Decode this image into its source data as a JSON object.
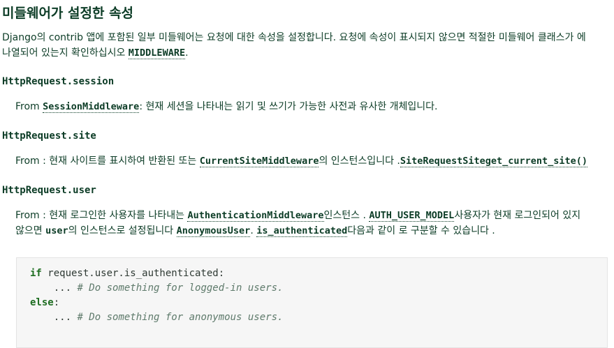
{
  "heading": "미들웨어가 설정한 속성",
  "intro": {
    "text": "Django의 contrib 앱에 포함된 일부 미들웨어는 요청에 대한 속성을 설정합니다. 요청에 속성이 표시되지 않으면 적절한 미들웨어 클래스가 에",
    "text2": "나열되어 있는지 확인하십시오 ",
    "code": "MIDDLEWARE",
    "end": "."
  },
  "session": {
    "title": "HttpRequest.session",
    "from": "From ",
    "code": "SessionMiddleware",
    "rest": ": 현재 세션을 나타내는 읽기 및 쓰기가 가능한 사전과 유사한 개체입니다."
  },
  "site": {
    "title": "HttpRequest.site",
    "from": "From : 현재 사이트를 표시하여 반환된 또는 ",
    "code1": "CurrentSiteMiddleware",
    "mid": "의 인스턴스입니다 .",
    "code2": "SiteRequestSiteget_current_site()"
  },
  "user": {
    "title": "HttpRequest.user",
    "from": "From : 현재 로그인한 사용자를 나타내는 ",
    "code1": "AuthenticationMiddleware",
    "mid1": "인스턴스 . ",
    "code2": "AUTH_USER_MODEL",
    "mid2": "사용자가 현재 로그인되어 있지",
    "line2a": "않으면 ",
    "code3": "user",
    "mid3": "의 인스턴스로 설정됩니다 ",
    "code4": "AnonymousUser",
    "sep": ". ",
    "code5": "is_authenticated",
    "end": "다음과 같이 로 구분할 수 있습니다 ."
  },
  "code": {
    "kw_if": "if",
    "cond": " request.user.is_authenticated:",
    "dots1": "    ... ",
    "comment1": "# Do something for logged-in users.",
    "kw_else": "else",
    "colon": ":",
    "dots2": "    ... ",
    "comment2": "# Do something for anonymous users."
  }
}
